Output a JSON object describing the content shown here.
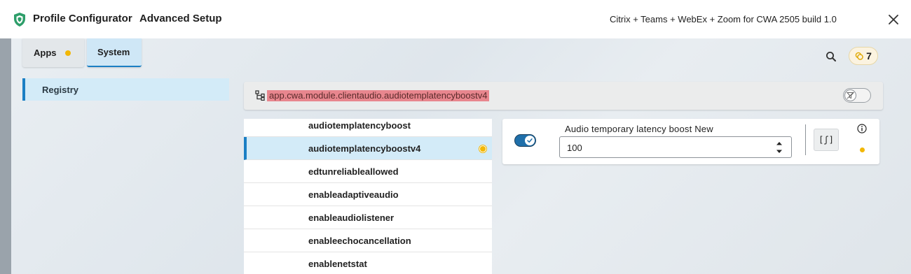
{
  "titlebar": {
    "app_title": "Profile Configurator",
    "subtitle": "Advanced Setup",
    "profile_name": "Citrix + Teams + WebEx + Zoom for CWA 2505 build 1.0",
    "icons": {
      "logo": "shield-icon",
      "close": "close-icon"
    }
  },
  "tabs": [
    {
      "label": "Apps",
      "modified": true,
      "selected": false
    },
    {
      "label": "System",
      "modified": false,
      "selected": true
    }
  ],
  "toolbar": {
    "search_icon": "search-icon",
    "badge_icon": "coins-icon",
    "badge_count": "7"
  },
  "sidebar": {
    "items": [
      {
        "label": "Registry",
        "selected": true
      }
    ]
  },
  "pathbar": {
    "icon": "tree-icon",
    "path": "app.cwa.module.clientaudio.audiotemplatencyboostv4",
    "filter_icon": "filter-off-icon"
  },
  "keys": [
    {
      "label": "audiotemplatencyboost",
      "selected": false,
      "modified": false
    },
    {
      "label": "audiotemplatencyboostv4",
      "selected": true,
      "modified": true
    },
    {
      "label": "edtunreliableallowed",
      "selected": false,
      "modified": false
    },
    {
      "label": "enableadaptiveaudio",
      "selected": false,
      "modified": false
    },
    {
      "label": "enableaudiolistener",
      "selected": false,
      "modified": false
    },
    {
      "label": "enableechocancellation",
      "selected": false,
      "modified": false
    },
    {
      "label": "enablenetstat",
      "selected": false,
      "modified": false
    }
  ],
  "detail": {
    "enabled": true,
    "label": "Audio temporary latency boost New",
    "value": "100",
    "function_button": "[ʃ]",
    "info_icon": "info-icon",
    "modified": true
  },
  "colors": {
    "accent": "#1b7fc4",
    "selected_bg": "#d3ebf8",
    "modified_dot": "#f2b705",
    "path_highlight": "#e8868e",
    "toggle_on": "#1f6faa"
  }
}
